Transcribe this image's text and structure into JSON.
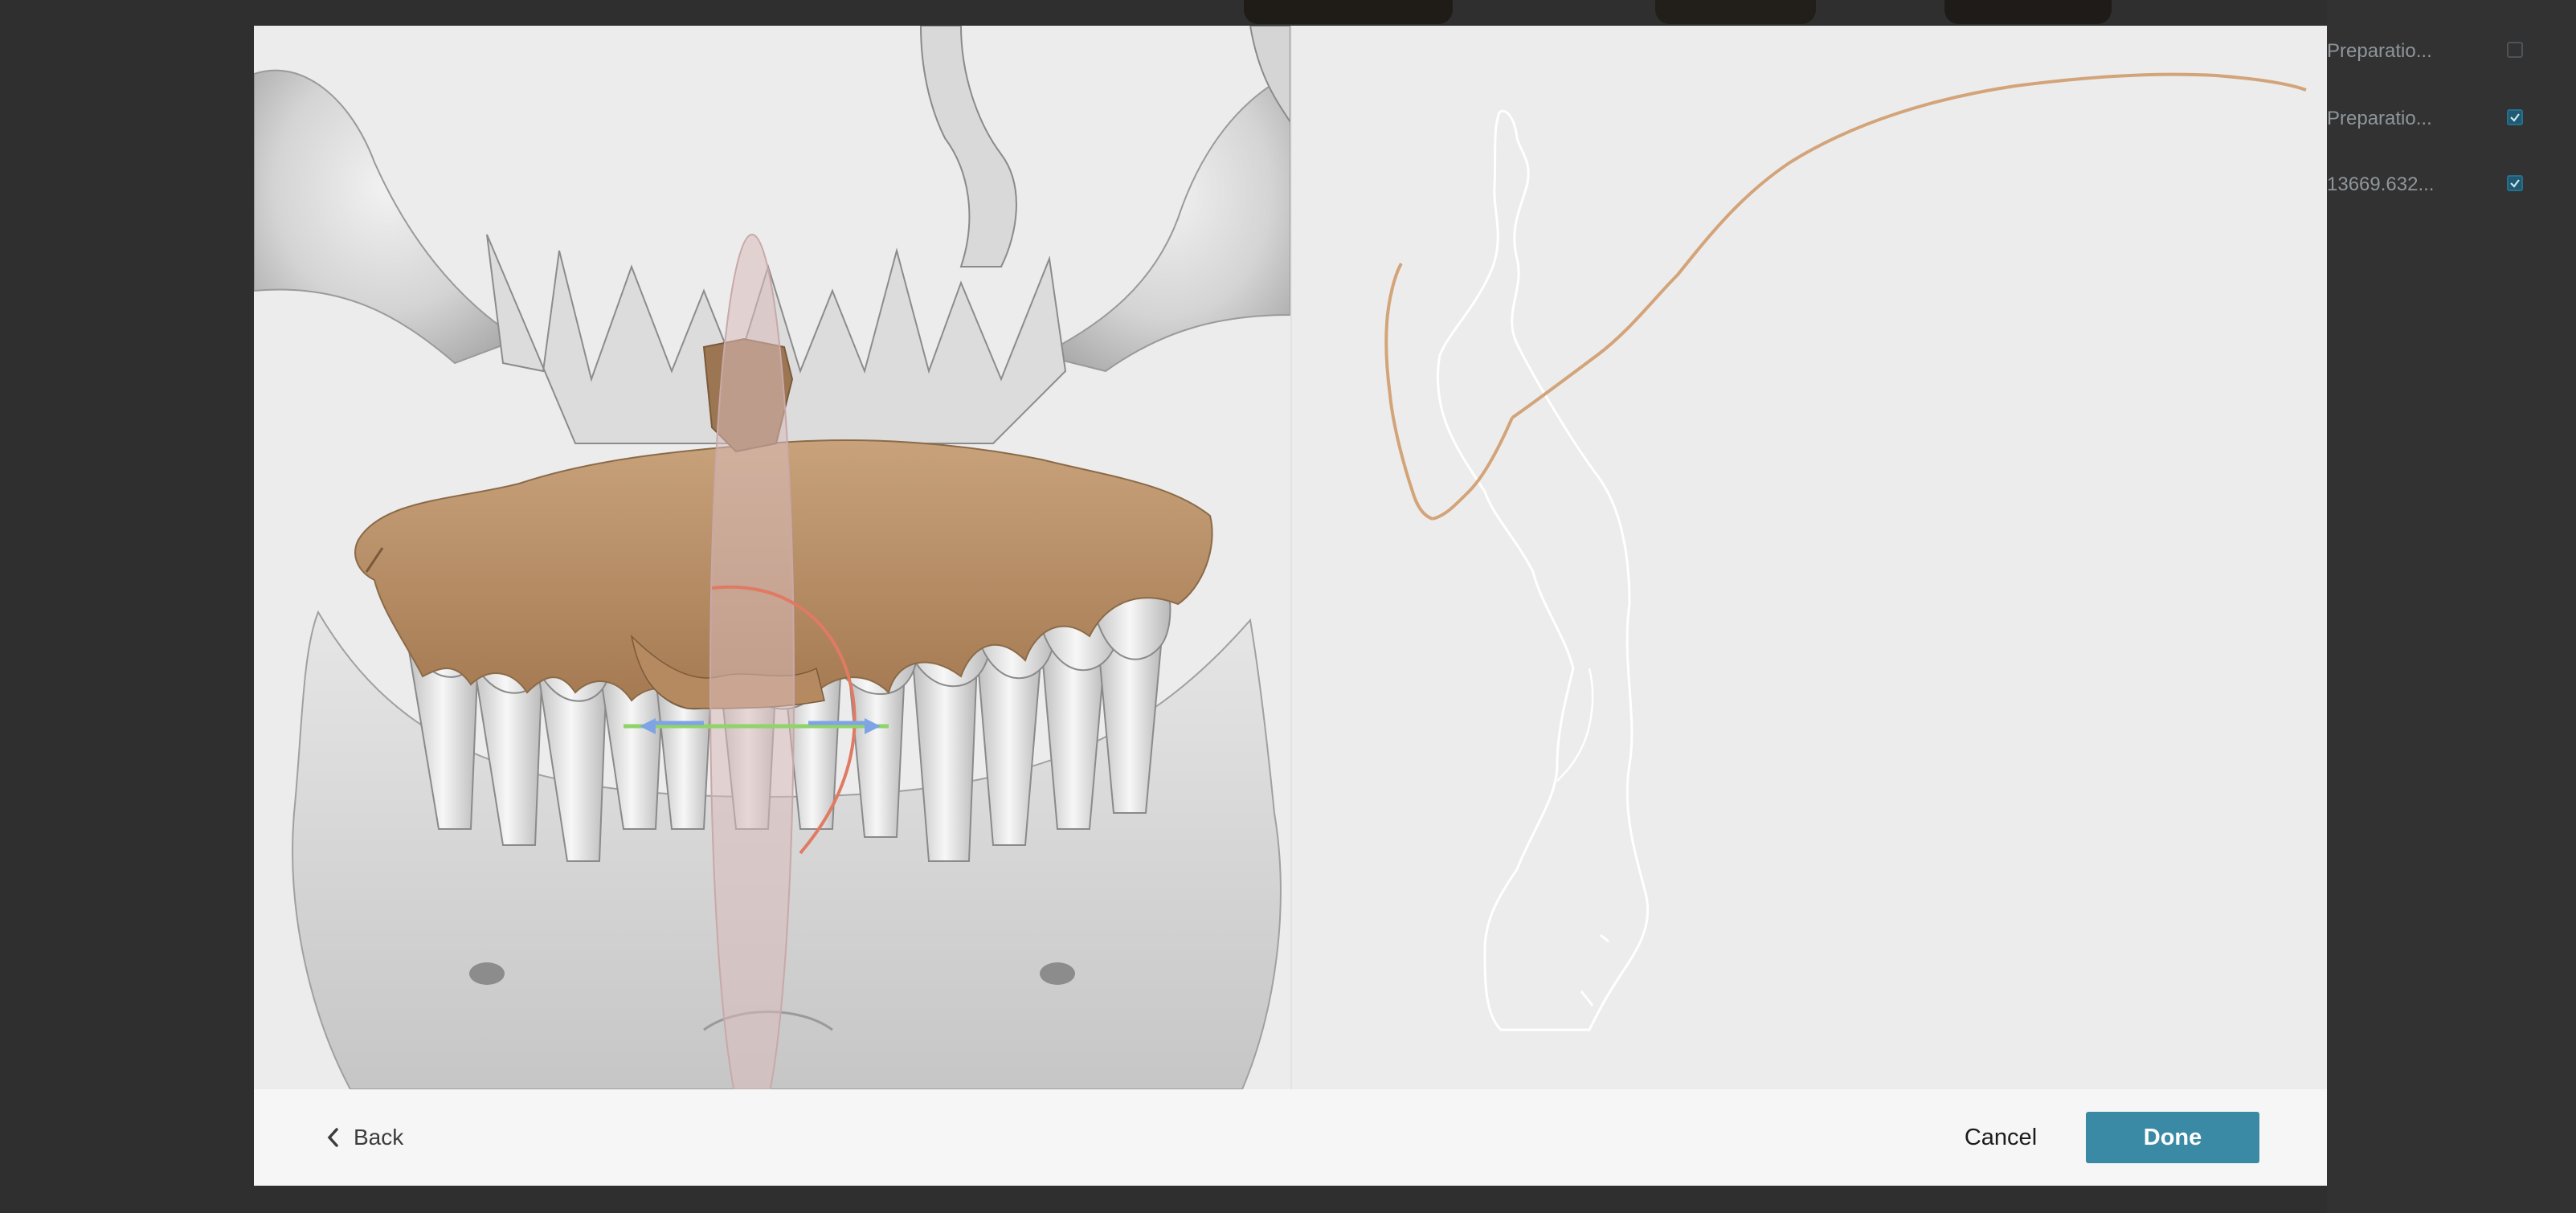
{
  "background_panel": {
    "rows": [
      {
        "label": "Preparatio...",
        "checked": false
      },
      {
        "label": "Preparatio...",
        "checked": true
      },
      {
        "label": "13669.632...",
        "checked": true
      }
    ]
  },
  "dialog": {
    "left_view": {
      "name": "3D model view"
    },
    "right_view": {
      "name": "cross-section view"
    },
    "footer": {
      "back_label": "Back",
      "cancel_label": "Cancel",
      "done_label": "Done"
    }
  },
  "colors": {
    "accent": "#3b8aa5",
    "gum": "#c4a07a",
    "bone": "#d9d9d9",
    "outline_tan": "#d3a479",
    "rotation_ring": "#e07a63",
    "axis_green": "#8fd46a",
    "axis_blue": "#7fa4e6"
  }
}
